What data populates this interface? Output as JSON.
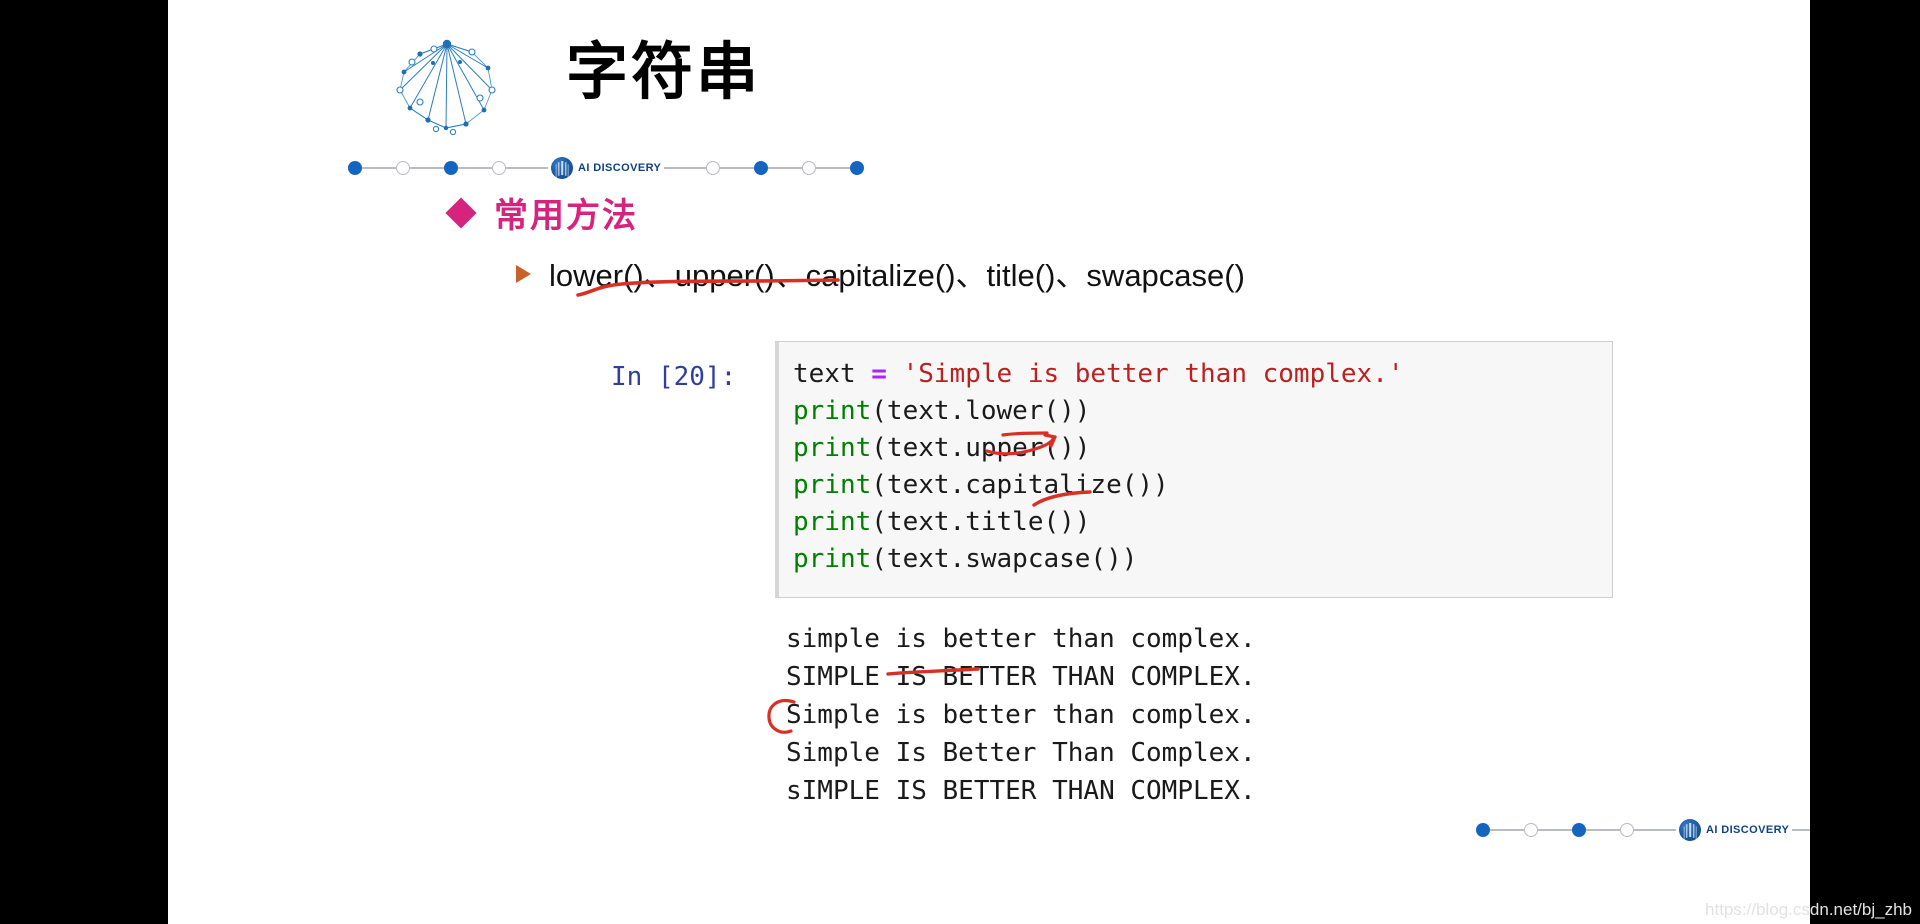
{
  "slide": {
    "title": "字符串",
    "logo_icon": "brain-network-icon",
    "section": {
      "bullet_icon": "diamond-bullet-icon",
      "heading": "常用方法"
    },
    "method_bullet": {
      "bullet_icon": "arrow-bullet-icon",
      "text": "lower()、upper()、capitalize()、title()、swapcase()"
    }
  },
  "rail": {
    "badge_label": "AI DISCOVERY",
    "badge_icon": "ai-discovery-emblem-icon",
    "dots": [
      "filled",
      "hollow",
      "filled",
      "hollow",
      "badge",
      "hollow",
      "filled",
      "hollow",
      "filled"
    ]
  },
  "notebook": {
    "prompt": "In [20]:",
    "code_lines": [
      {
        "tokens": [
          {
            "text": "text ",
            "type": "plain"
          },
          {
            "text": "=",
            "type": "op"
          },
          {
            "text": " ",
            "type": "plain"
          },
          {
            "text": "'Simple is better than complex.'",
            "type": "str"
          }
        ]
      },
      {
        "tokens": [
          {
            "text": "print",
            "type": "kw"
          },
          {
            "text": "(text.lower())",
            "type": "plain"
          }
        ]
      },
      {
        "tokens": [
          {
            "text": "print",
            "type": "kw"
          },
          {
            "text": "(text.upper())",
            "type": "plain"
          }
        ]
      },
      {
        "tokens": [
          {
            "text": "print",
            "type": "kw"
          },
          {
            "text": "(text.capitalize())",
            "type": "plain"
          }
        ]
      },
      {
        "tokens": [
          {
            "text": "print",
            "type": "kw"
          },
          {
            "text": "(text.title())",
            "type": "plain"
          }
        ]
      },
      {
        "tokens": [
          {
            "text": "print",
            "type": "kw"
          },
          {
            "text": "(text.swapcase())",
            "type": "plain"
          }
        ]
      }
    ],
    "output_lines": [
      "simple is better than complex.",
      "SIMPLE IS BETTER THAN COMPLEX.",
      "Simple is better than complex.",
      "Simple Is Better Than Complex.",
      "sIMPLE IS BETTER THAN COMPLEX."
    ]
  },
  "annotations": {
    "color": "#d93025",
    "marks": [
      "underline-lower-upper",
      "strike-upper-in-code",
      "underline-capitalize-in-code",
      "strike-IS-in-output",
      "circle-S-in-output"
    ]
  },
  "colors": {
    "accent_pink": "#d6237e",
    "rail_blue": "#1565c0",
    "prompt_blue": "#303f9f",
    "string_red": "#ba2121",
    "keyword_green": "#008000",
    "operator_purple": "#aa22ff",
    "letterbox_black": "#000000",
    "cell_background": "#f7f7f7"
  },
  "watermark": "https://blog.csdn.net/bj_zhb"
}
